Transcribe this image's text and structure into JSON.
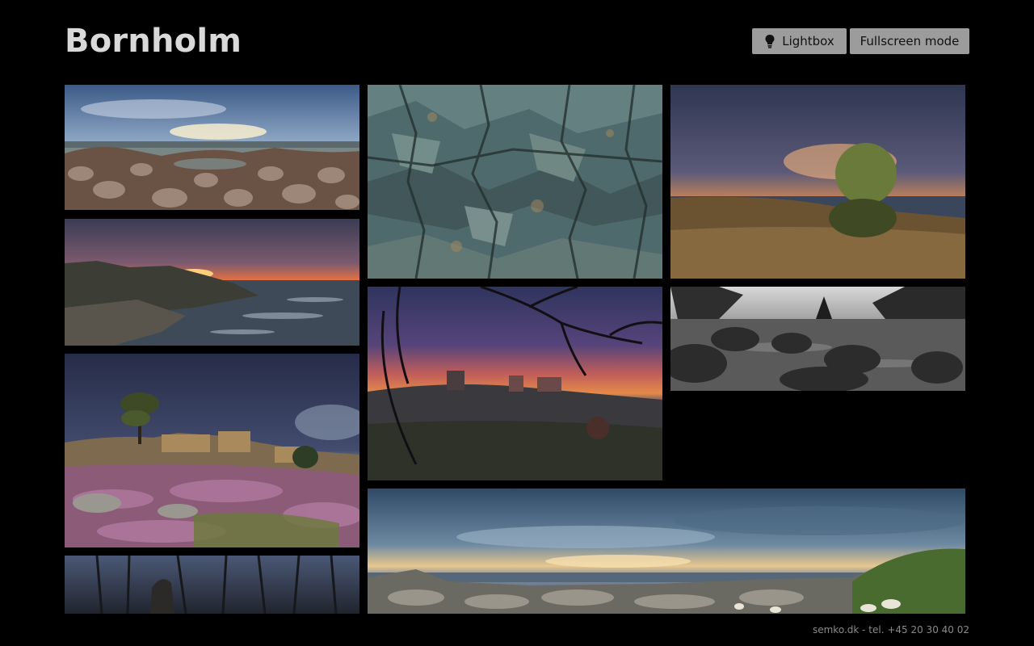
{
  "header": {
    "title": "Bornholm",
    "buttons": {
      "lightbox": {
        "label": "Lightbox",
        "icon": "lightbulb-icon"
      },
      "fullscreen": {
        "label": "Fullscreen mode"
      }
    }
  },
  "gallery": {
    "photos": [
      {
        "name": "rocky-coast-sunset-panorama"
      },
      {
        "name": "granite-rock-texture"
      },
      {
        "name": "tree-on-heath-sunset"
      },
      {
        "name": "coastline-sunset-waves"
      },
      {
        "name": "castle-ruins-twilight"
      },
      {
        "name": "black-and-white-rock-stream"
      },
      {
        "name": "lone-tree-heather-rocks"
      },
      {
        "name": "sea-panorama-dusk"
      },
      {
        "name": "forest-standing-stone"
      }
    ]
  },
  "footer": {
    "text": "semko.dk - tel. +45 20 30 40 02"
  },
  "colors": {
    "background": "#000000",
    "title": "#d9d9d9",
    "button": "#9c9c9c",
    "footer": "#8a8a8a"
  }
}
